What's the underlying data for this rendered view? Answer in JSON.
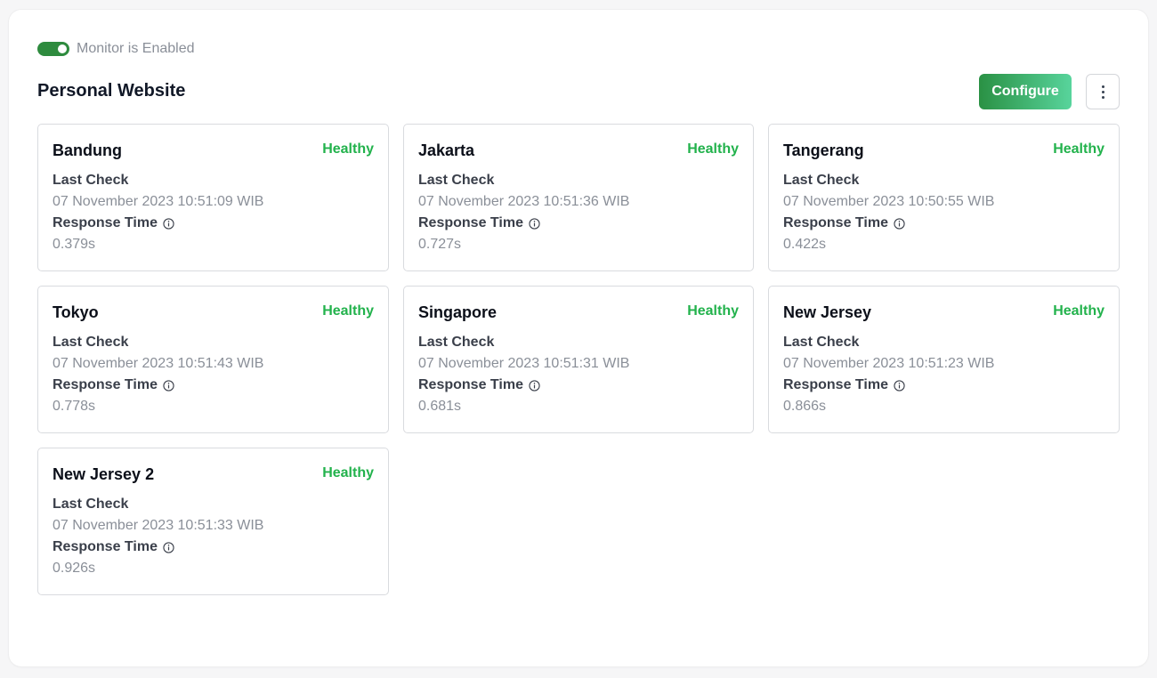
{
  "monitor": {
    "enabled": true,
    "toggle_label": "Monitor is Enabled",
    "title": "Personal Website"
  },
  "toolbar": {
    "configure_label": "Configure",
    "more_icon": "vertical-ellipsis-icon"
  },
  "labels": {
    "last_check": "Last Check",
    "response_time": "Response Time",
    "info_icon": "info-icon"
  },
  "colors": {
    "accent": "#2e8b3e",
    "healthy": "#22b24c",
    "configure_gradient_start": "#2a9144",
    "configure_gradient_end": "#58d49c"
  },
  "locations": [
    {
      "name": "Bandung",
      "status": "Healthy",
      "last_check": "07 November 2023 10:51:09 WIB",
      "response_time": "0.379s"
    },
    {
      "name": "Jakarta",
      "status": "Healthy",
      "last_check": "07 November 2023 10:51:36 WIB",
      "response_time": "0.727s"
    },
    {
      "name": "Tangerang",
      "status": "Healthy",
      "last_check": "07 November 2023 10:50:55 WIB",
      "response_time": "0.422s"
    },
    {
      "name": "Tokyo",
      "status": "Healthy",
      "last_check": "07 November 2023 10:51:43 WIB",
      "response_time": "0.778s"
    },
    {
      "name": "Singapore",
      "status": "Healthy",
      "last_check": "07 November 2023 10:51:31 WIB",
      "response_time": "0.681s"
    },
    {
      "name": "New Jersey",
      "status": "Healthy",
      "last_check": "07 November 2023 10:51:23 WIB",
      "response_time": "0.866s"
    },
    {
      "name": "New Jersey 2",
      "status": "Healthy",
      "last_check": "07 November 2023 10:51:33 WIB",
      "response_time": "0.926s"
    }
  ]
}
